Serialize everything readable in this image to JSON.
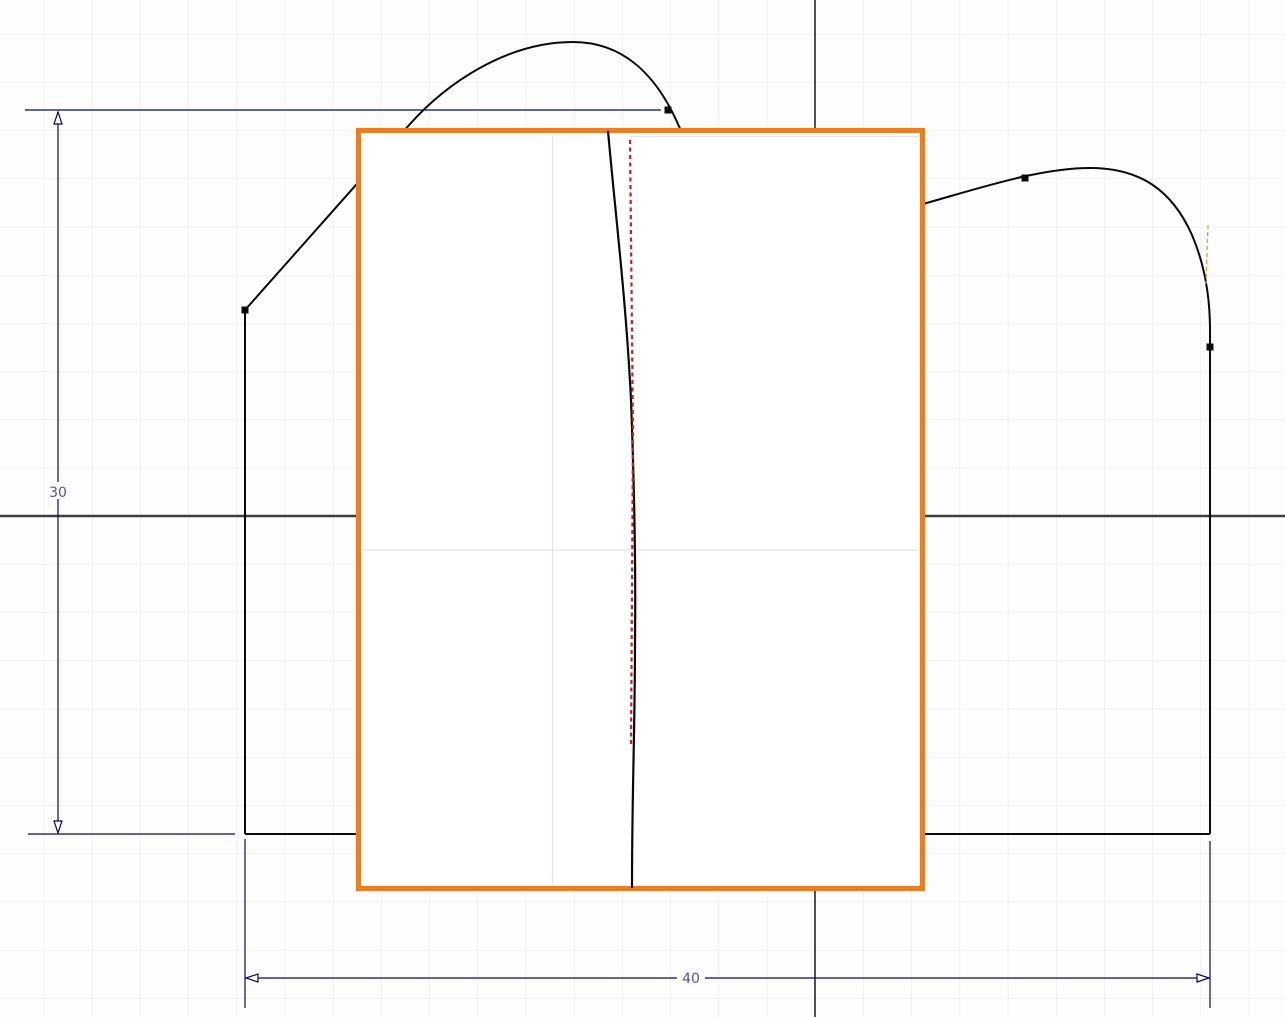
{
  "canvas": {
    "title": "cad-sketch-viewport"
  },
  "dimensions": {
    "vertical": {
      "label": "30"
    },
    "horizontal": {
      "label": "40"
    }
  },
  "colors": {
    "background": "#fdfdfd",
    "grid": "#e8e8e8",
    "axis": "#3e3e3e",
    "edge": "#0a0a0a",
    "selection_orange": "#ED7D23",
    "plane_fill": "#ffffff",
    "construction_red": "#CC1F1F",
    "tangent_orange": "#E09A40",
    "dimension_navy": "#0a0a64",
    "dimension_text": "#55519E",
    "slice_line": "#e4e4e4"
  }
}
